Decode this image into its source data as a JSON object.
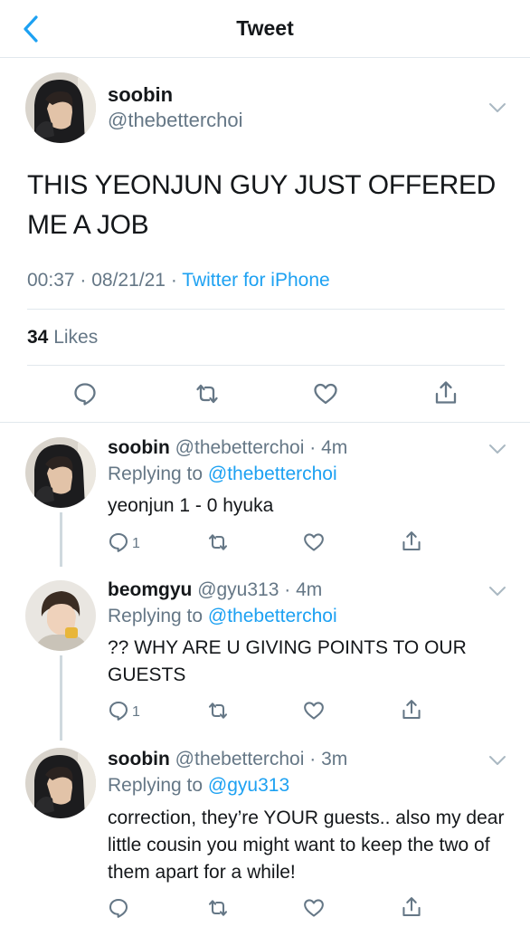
{
  "header": {
    "title": "Tweet"
  },
  "main_tweet": {
    "name": "soobin",
    "handle": "@thebetterchoi",
    "text": "THIS YEONJUN GUY JUST OFFERED ME A JOB",
    "time": "00:37",
    "date": "08/21/21",
    "source": "Twitter for iPhone",
    "likes_count": "34",
    "likes_label": "Likes"
  },
  "replies": [
    {
      "name": "soobin",
      "handle": "@thebetterchoi",
      "time": "4m",
      "replying_label": "Replying to",
      "replying_to": "@thebetterchoi",
      "text": "yeonjun 1 - 0 hyuka",
      "reply_count": "1"
    },
    {
      "name": "beomgyu",
      "handle": "@gyu313",
      "time": "4m",
      "replying_label": "Replying to",
      "replying_to": "@thebetterchoi",
      "text": "?? WHY ARE U GIVING POINTS TO OUR GUESTS",
      "reply_count": "1"
    },
    {
      "name": "soobin",
      "handle": "@thebetterchoi",
      "time": "3m",
      "replying_label": "Replying to",
      "replying_to": "@gyu313",
      "text": "correction, they’re YOUR guests.. also my dear little cousin you might want to keep the two of them apart for a while!",
      "reply_count": ""
    }
  ],
  "icons": {
    "back": "chevron-left-icon",
    "menu": "chevron-down-icon",
    "reply": "comment-icon",
    "retweet": "retweet-icon",
    "like": "heart-icon",
    "share": "share-icon"
  },
  "colors": {
    "accent": "#1da1f2",
    "secondary_text": "#657786",
    "divider": "#e1e8ed",
    "icon": "#657786"
  }
}
